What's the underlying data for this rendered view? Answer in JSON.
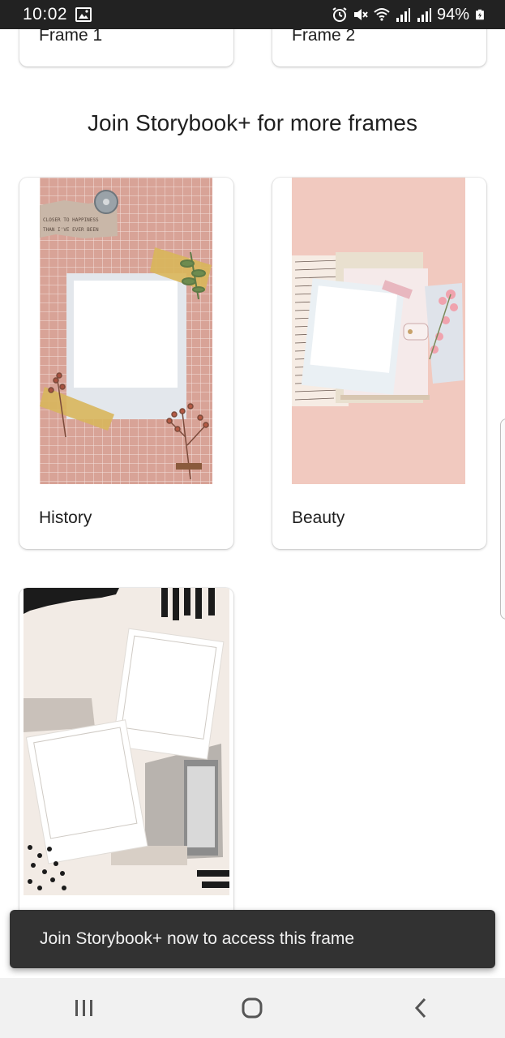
{
  "status_bar": {
    "time": "10:02",
    "battery": "94%",
    "icons": [
      "image-icon",
      "alarm-icon",
      "mute-icon",
      "wifi-icon",
      "signal-icon",
      "signal-icon",
      "battery-icon"
    ]
  },
  "frames_top": [
    {
      "label": "Frame 1"
    },
    {
      "label": "Frame 2"
    }
  ],
  "heading": "Join Storybook+ for more frames",
  "premium_frames": [
    {
      "label": "History",
      "thumb_icon": "history-frame-thumbnail"
    },
    {
      "label": "Beauty",
      "thumb_icon": "beauty-frame-thumbnail"
    },
    {
      "label": "",
      "thumb_icon": "collage-frame-thumbnail"
    }
  ],
  "history_thumb_text": {
    "line1": "CLOSER TO HAPPINESS",
    "line2": "THAN I'VE EVER BEEN"
  },
  "snackbar": {
    "message": "Join Storybook+ now to access this frame"
  },
  "nav": {
    "icons": [
      "recent-apps-icon",
      "home-icon",
      "back-icon"
    ]
  },
  "colors": {
    "status_bar": "#222222",
    "snackbar": "#323232",
    "nav_bar": "#f1f1f1",
    "history_bg": "#d9a49a",
    "beauty_bg": "#f1c9bf"
  }
}
